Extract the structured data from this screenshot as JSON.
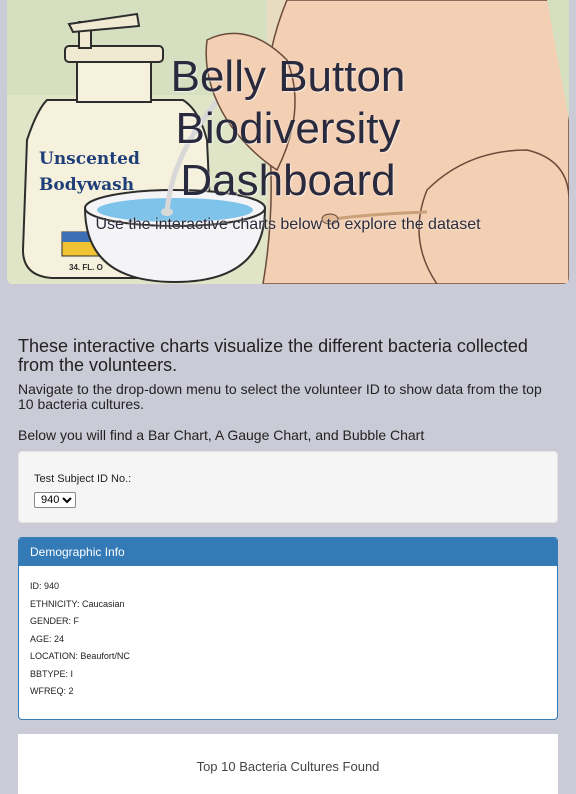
{
  "hero": {
    "title_line1": "Belly Button",
    "title_line2": "Biodiversity",
    "title_line3": "Dashboard",
    "subtitle": "Use the interactive charts below to explore the dataset",
    "bottle_label_line1": "Unscented",
    "bottle_label_line2": "Bodywash",
    "bottle_size": "34. FL. O"
  },
  "intro": {
    "heading": "These interactive charts visualize the different bacteria collected from the volunteers.",
    "navigate": "Navigate to the drop-down menu to select the volunteer ID to show data from the top 10 bacteria cultures.",
    "chart_types": "Below you will find a Bar Chart, A Gauge Chart, and Bubble Chart"
  },
  "selector": {
    "label": "Test Subject ID No.:",
    "selected": "940"
  },
  "demographics": {
    "heading": "Demographic Info",
    "lines": [
      "ID: 940",
      "ETHNICITY: Caucasian",
      "GENDER: F",
      "AGE: 24",
      "LOCATION: Beaufort/NC",
      "BBTYPE: I",
      "WFREQ: 2"
    ]
  },
  "bar_chart": {
    "title": "Top 10 Bacteria Cultures Found"
  },
  "colors": {
    "page_bg": "#cbcbd8",
    "panel_primary": "#337ab7",
    "well_bg": "#f5f5f5"
  }
}
